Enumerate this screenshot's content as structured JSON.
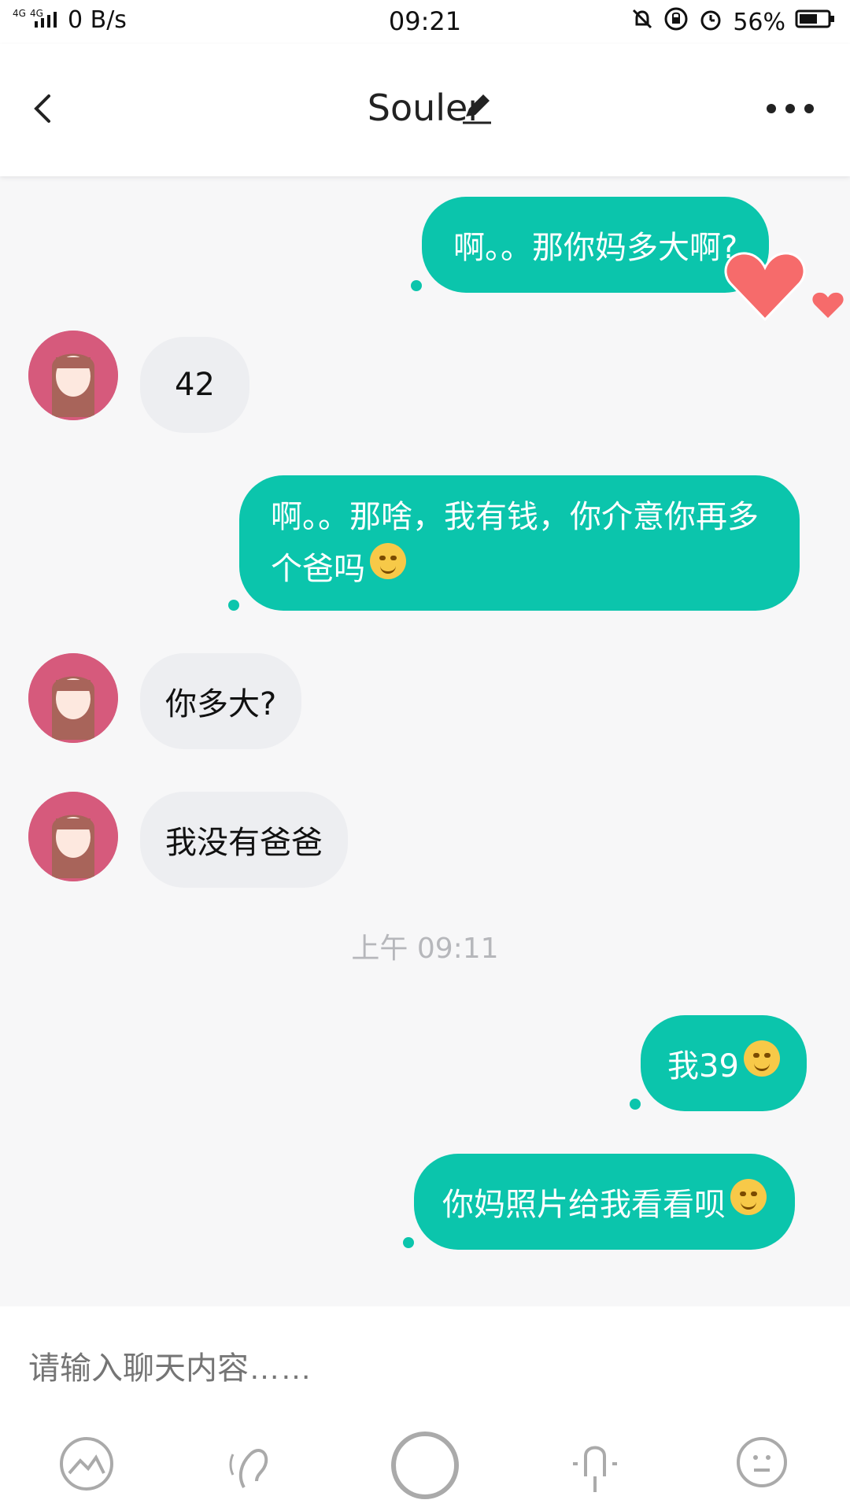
{
  "status_bar": {
    "network": "4G 4G",
    "speed": "0 B/s",
    "time": "09:21",
    "battery": "56%"
  },
  "header": {
    "title": "Souler"
  },
  "messages": [
    {
      "from": "me",
      "text": "啊。。那你妈多大啊?"
    },
    {
      "from": "other",
      "text": "42"
    },
    {
      "from": "me",
      "text": "啊。。那啥，我有钱，你介意你再多个爸吗"
    },
    {
      "from": "other",
      "text": "你多大?"
    },
    {
      "from": "other",
      "text": "我没有爸爸"
    },
    {
      "from": "me",
      "text": "我39"
    },
    {
      "from": "me",
      "text": "你妈照片给我看看呗"
    }
  ],
  "timestamp": "上午 09:11",
  "input": {
    "placeholder": "请输入聊天内容……"
  },
  "toolbar": {
    "items": [
      "image-icon",
      "bubble-icon",
      "voice-record-icon",
      "mic-icon",
      "emoji-icon"
    ]
  },
  "colors": {
    "accent": "#0bc5ac",
    "other_bubble": "#edeef1",
    "background": "#f7f7f8"
  }
}
